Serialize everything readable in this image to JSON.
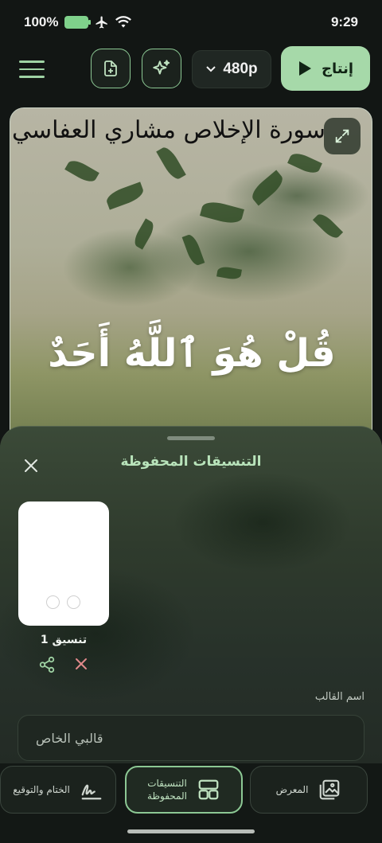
{
  "status": {
    "battery": "100%",
    "time": "9:29"
  },
  "toolbar": {
    "resolution": "480p",
    "produce_label": "إنتاج"
  },
  "preview": {
    "surah_title": "سورة الإخلاص مشاري العفاسي",
    "verse": "قُلْ هُوَ ٱللَّهُ أَحَدٌ"
  },
  "sheet": {
    "title": "التنسيقات المحفوظة",
    "card_label": "تنسيق 1",
    "field_label": "اسم القالب",
    "field_placeholder": "قالبي الخاص"
  },
  "nav": {
    "gallery": "المعرض",
    "saved_line1": "التنسيقات",
    "saved_line2": "المحفوظة",
    "signature": "الختام والتوقيع"
  },
  "colors": {
    "accent": "#a6d9a9",
    "accent_border": "#8cc894",
    "danger": "#e0898a"
  }
}
